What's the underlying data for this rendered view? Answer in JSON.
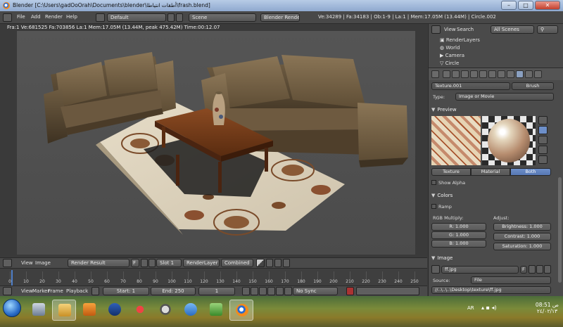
{
  "window": {
    "title": "Blender  [C:\\Users\\gadOoOrah\\Documents\\blender\\أطقات انتياطا\\frash.blend]",
    "minimize": "–",
    "maximize": "□",
    "close": "✕"
  },
  "info_header": {
    "menus": [
      "File",
      "Add",
      "Render",
      "Help"
    ],
    "screen": "Default",
    "scene": "Scene",
    "engine": "Blender Render",
    "stats": "Ve:34289 | Fa:34183 | Ob:1-9 | La:1 | Mem:17.05M (13.44M) | Circle.002"
  },
  "viewport": {
    "render_info": "Fra:1  Ve:681525 Fa:703856 La:1 Mem:17.05M (13.44M, peak 475.42M) Time:00:12.07"
  },
  "image_header": {
    "menus": [
      "View",
      "Image"
    ],
    "image_name": "Render Result",
    "fake_user": "F",
    "slot": "Slot 1",
    "layer": "RenderLayer",
    "pass": "Combined"
  },
  "timeline": {
    "ticks": [
      "0",
      "10",
      "20",
      "30",
      "40",
      "50",
      "60",
      "70",
      "80",
      "90",
      "100",
      "110",
      "120",
      "130",
      "140",
      "150",
      "160",
      "170",
      "180",
      "190",
      "200",
      "210",
      "220",
      "230",
      "240",
      "250"
    ],
    "menus": [
      "View",
      "Marker",
      "Frame",
      "Playback"
    ],
    "start": "Start: 1",
    "end": "End: 250",
    "current": "1",
    "sync": "No Sync"
  },
  "outliner": {
    "menus": [
      "View",
      "Search"
    ],
    "filter": "All Scenes",
    "items": [
      "RenderLayers",
      "World",
      "Camera",
      "Circle"
    ]
  },
  "properties": {
    "texture_name": "Texture.001",
    "texture_brush": "Brush",
    "type_label": "Type:",
    "type_value": "Image or Movie",
    "preview_title": "Preview",
    "preview_tabs": [
      "Texture",
      "Material",
      "Both"
    ],
    "show_alpha": "Show Alpha",
    "colors_title": "Colors",
    "ramp": "Ramp",
    "rgb_label": "RGB Multiply:",
    "adjust_label": "Adjust:",
    "r": "R: 1.000",
    "g": "G: 1.000",
    "b": "B: 1.000",
    "brightness": "Brightness: 1.000",
    "contrast": "Contrast: 1.000",
    "saturation": "Saturation: 1.000",
    "image_title": "Image",
    "image_file": "ff.jpg",
    "fake": "F",
    "source_label": "Source:",
    "source_value": "File",
    "path": "//..\\..\\..\\Desktop\\texture\\ff.jpg"
  },
  "taskbar": {
    "lang": "AR",
    "time": "08:51 ص",
    "date": "٢٤/٠٢/١٣"
  },
  "colors": {
    "accent": "#5677b3",
    "panel": "#4b4b4b",
    "header": "#484848"
  }
}
